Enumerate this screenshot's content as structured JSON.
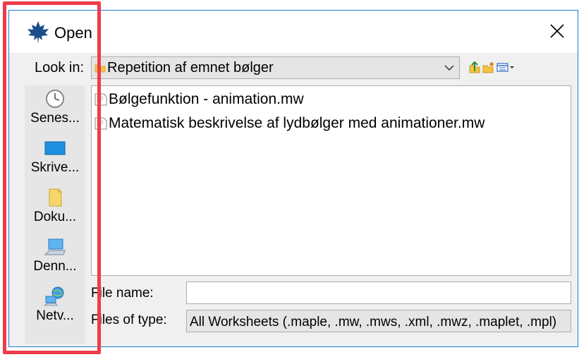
{
  "dialog": {
    "title": "Open",
    "app_icon": "maple-leaf-icon",
    "close_icon": "close-icon"
  },
  "look_in": {
    "label": "Look in:",
    "value": "Repetition af emnet bølger",
    "folder_icon": "folder-icon",
    "toolbar_icons": [
      "up-folder-icon",
      "new-folder-icon",
      "view-menu-icon"
    ]
  },
  "places": [
    {
      "label": "Senes...",
      "icon": "recent-clock-icon"
    },
    {
      "label": "Skrive...",
      "icon": "desktop-icon"
    },
    {
      "label": "Doku...",
      "icon": "documents-icon"
    },
    {
      "label": "Denn...",
      "icon": "computer-icon"
    },
    {
      "label": "Netv...",
      "icon": "network-icon"
    }
  ],
  "files": [
    {
      "name": "Bølgefunktion - animation.mw",
      "icon": "maple-document-icon"
    },
    {
      "name": "Matematisk beskrivelse af lydbølger med animationer.mw",
      "icon": "maple-document-icon"
    }
  ],
  "file_name": {
    "label": "File name:",
    "value": "",
    "placeholder": ""
  },
  "file_type": {
    "label": "Files of type:",
    "value": "All Worksheets (.maple, .mw, .mws, .xml, .mwz, .maplet, .mpl)"
  },
  "colors": {
    "highlight": "#ee3c4a",
    "dialog_border": "#1a7fd0",
    "maple_red": "#1b4f8a"
  }
}
